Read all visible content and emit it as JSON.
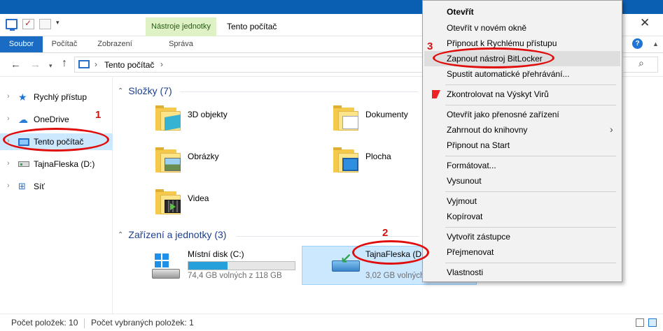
{
  "window": {
    "title": "Tento počítač",
    "contextual_tab": "Nástroje jednotky",
    "close_glyph": "✕"
  },
  "ribbon": {
    "tabs": [
      "Soubor",
      "Počítač",
      "Zobrazení",
      "Správa"
    ]
  },
  "address": {
    "path_label": "Tento počítač"
  },
  "sidebar": {
    "items": [
      {
        "label": "Rychlý přístup",
        "icon": "star-icon"
      },
      {
        "label": "OneDrive",
        "icon": "cloud-icon"
      },
      {
        "label": "Tento počítač",
        "icon": "monitor-icon",
        "selected": true
      },
      {
        "label": "TajnaFleska (D:)",
        "icon": "drive-icon"
      },
      {
        "label": "Síť",
        "icon": "network-icon"
      }
    ]
  },
  "main": {
    "folders_header": "Složky (7)",
    "folders": [
      {
        "name": "3D objekty",
        "icon": "3d-objects-folder-icon"
      },
      {
        "name": "Dokumenty",
        "icon": "documents-folder-icon"
      },
      {
        "name": "Obrázky",
        "icon": "pictures-folder-icon"
      },
      {
        "name": "Plocha",
        "icon": "desktop-folder-icon"
      },
      {
        "name": "Videa",
        "icon": "videos-folder-icon"
      }
    ],
    "devices_header": "Zařízení a jednotky (3)",
    "devices": [
      {
        "name": "Místní disk (C:)",
        "free_text": "74,4 GB volných z 118 GB",
        "used_fraction": 0.37
      },
      {
        "name": "TajnaFleska (D:)",
        "free_text": "3,02 GB volných",
        "selected": true
      }
    ]
  },
  "status": {
    "items_count": "Počet položek: 10",
    "selected_count": "Počet vybraných položek: 1"
  },
  "context_menu": {
    "items": [
      {
        "label": "Otevřít",
        "bold": true
      },
      {
        "label": "Otevřít v novém okně"
      },
      {
        "label": "Připnout k Rychlému přístupu"
      },
      {
        "label": "Zapnout nástroj BitLocker",
        "highlighted": true
      },
      {
        "label": "Spustit automatické přehrávání..."
      },
      {
        "label": "Zkontrolovat na Výskyt Virů",
        "icon": "antivirus-shield-icon"
      },
      {
        "label": "Otevřít jako přenosné zařízení"
      },
      {
        "label": "Zahrnout do knihovny",
        "submenu": true
      },
      {
        "label": "Připnout na Start"
      },
      {
        "label": "Formátovat..."
      },
      {
        "label": "Vysunout"
      },
      {
        "label": "Vyjmout"
      },
      {
        "label": "Kopírovat"
      },
      {
        "label": "Vytvořit zástupce"
      },
      {
        "label": "Přejmenovat"
      },
      {
        "label": "Vlastnosti"
      }
    ]
  },
  "annotations": {
    "step1": "1",
    "step2": "2",
    "step3": "3",
    "color": "#e00d0d"
  },
  "colors": {
    "accent": "#1a6bc4",
    "contextual_tab_bg": "#dff2c6",
    "selection_bg": "#cce8ff",
    "disk_bar_fill": "#26a0da"
  }
}
